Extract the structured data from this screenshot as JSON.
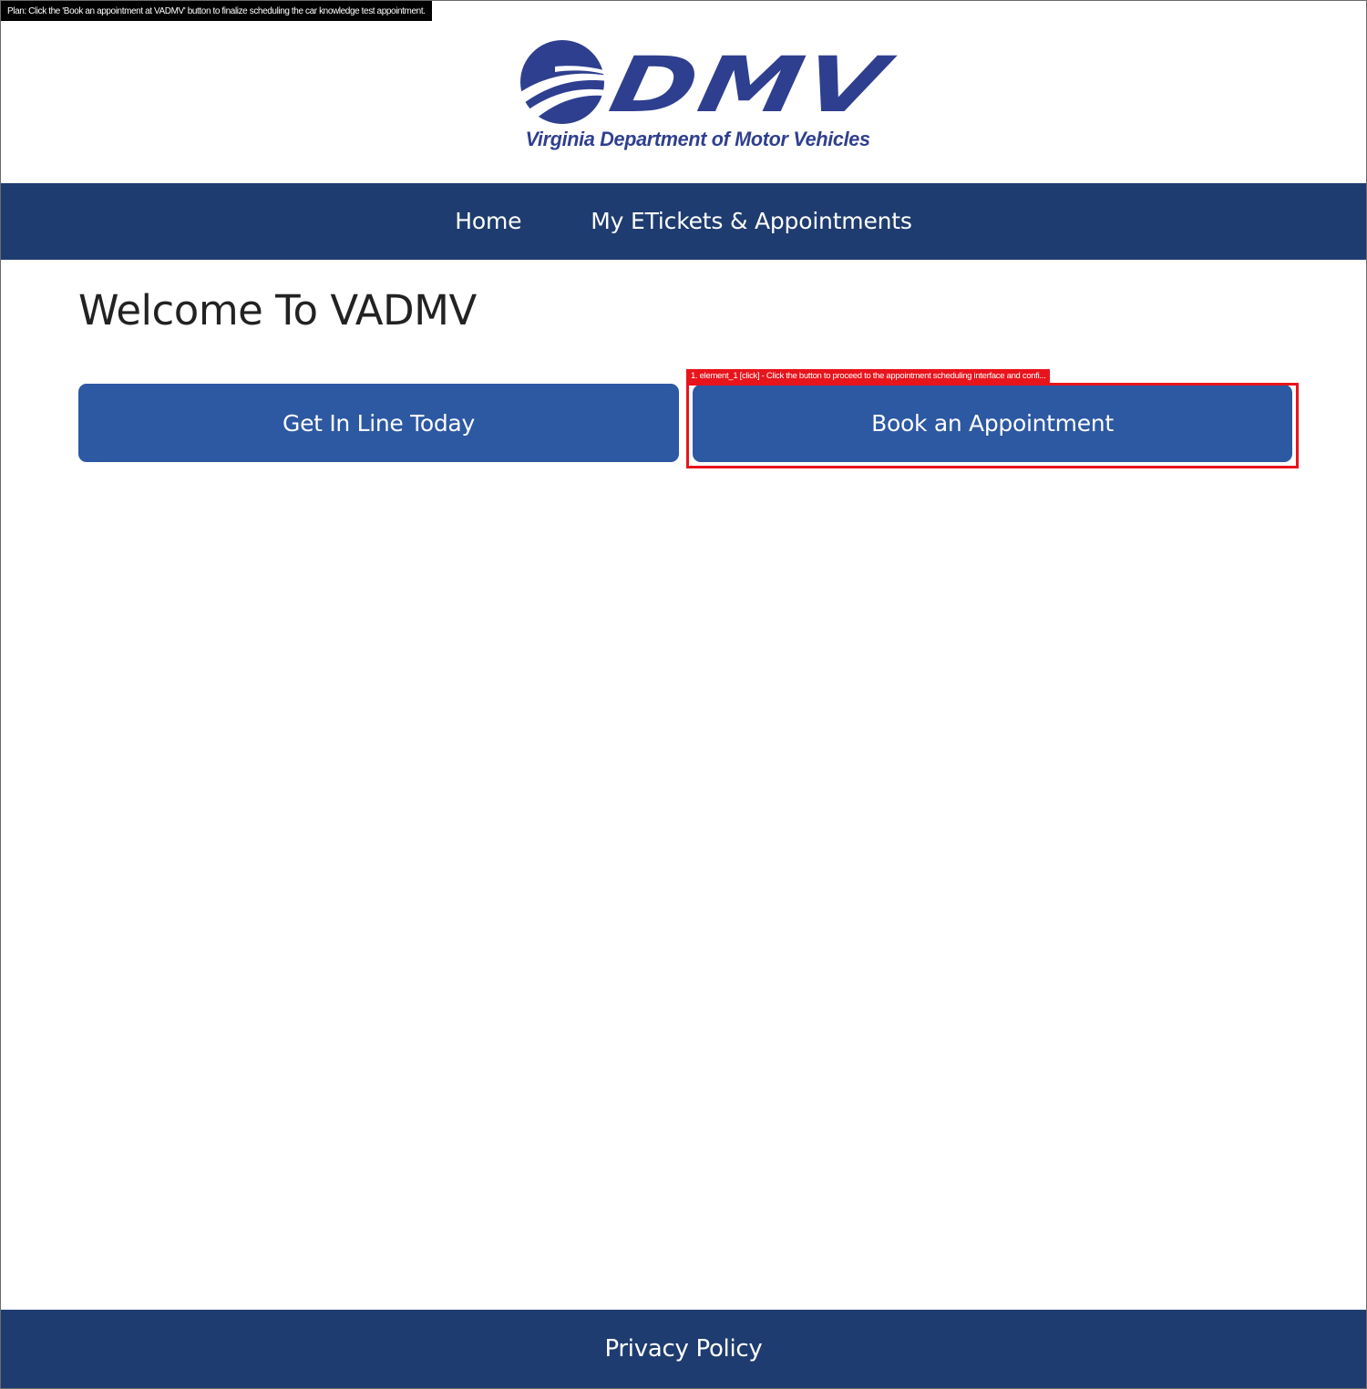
{
  "overlay": {
    "plan_text": "Plan: Click the 'Book an appointment at VADMV' button to finalize scheduling the car knowledge test appointment.",
    "highlight_label": "1. element_1 [click] - Click the button to proceed to the appointment scheduling interface and confi...",
    "highlight_color": "#e8141c"
  },
  "header": {
    "logo_text": "DMV",
    "logo_subtitle": "Virginia Department of Motor Vehicles",
    "logo_color": "#2f3f8f"
  },
  "nav": {
    "items": [
      {
        "label": "Home"
      },
      {
        "label": "My ETickets & Appointments"
      }
    ],
    "background": "#1f3c70"
  },
  "main": {
    "title": "Welcome To VADMV",
    "buttons": {
      "get_in_line": "Get In Line Today",
      "book_appointment": "Book an Appointment"
    },
    "button_color": "#2d58a2"
  },
  "footer": {
    "privacy_link": "Privacy Policy"
  }
}
